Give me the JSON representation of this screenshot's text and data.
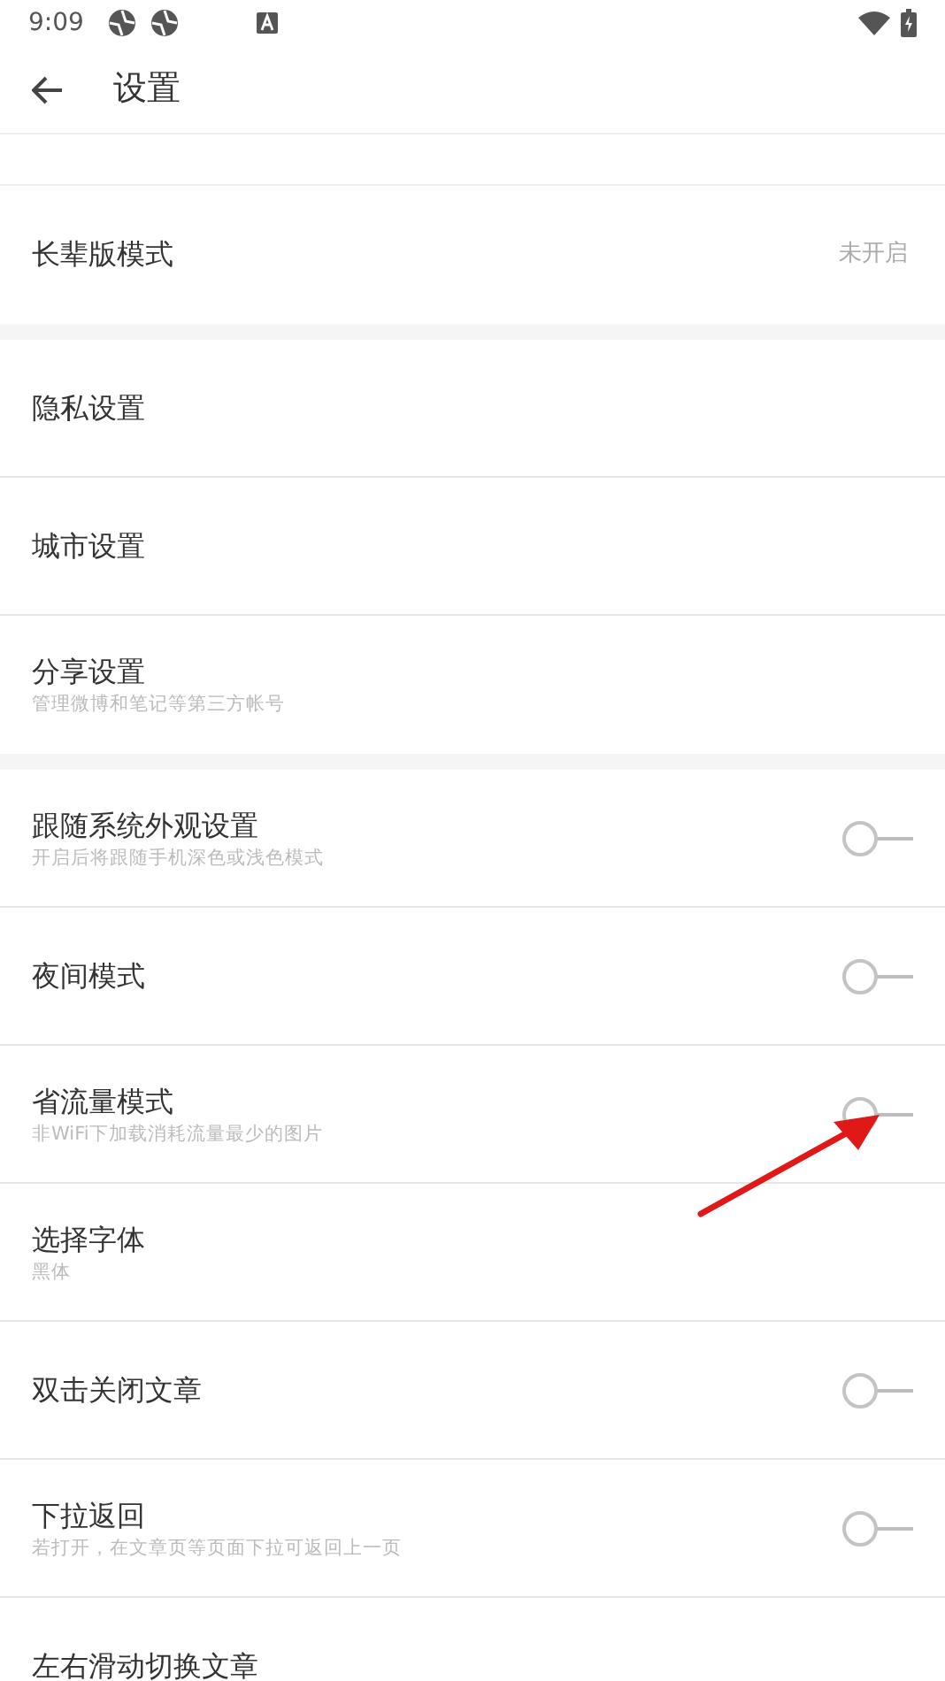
{
  "status_bar": {
    "time": "9:09"
  },
  "header": {
    "title": "设置"
  },
  "sections": [
    {
      "items": [
        {
          "kind": "value",
          "title": "长辈版模式",
          "value": "未开启"
        }
      ]
    },
    {
      "items": [
        {
          "kind": "plain",
          "title": "隐私设置"
        },
        {
          "kind": "plain",
          "title": "城市设置"
        },
        {
          "kind": "plain",
          "title": "分享设置",
          "subtitle": "管理微博和笔记等第三方帐号"
        }
      ]
    },
    {
      "items": [
        {
          "kind": "toggle",
          "title": "跟随系统外观设置",
          "subtitle": "开启后将跟随手机深色或浅色模式",
          "on": false
        },
        {
          "kind": "toggle",
          "title": "夜间模式",
          "on": false
        },
        {
          "kind": "toggle",
          "title": "省流量模式",
          "subtitle": "非WiFi下加载消耗流量最少的图片",
          "on": false
        },
        {
          "kind": "plain",
          "title": "选择字体",
          "subtitle": "黑体"
        },
        {
          "kind": "toggle",
          "title": "双击关闭文章",
          "on": false
        },
        {
          "kind": "toggle",
          "title": "下拉返回",
          "subtitle": "若打开，在文章页等页面下拉可返回上一页",
          "on": false
        },
        {
          "kind": "plain",
          "title": "左右滑动切换文章"
        }
      ]
    }
  ]
}
